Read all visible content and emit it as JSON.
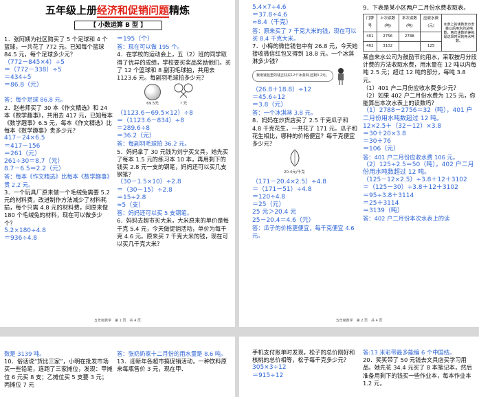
{
  "page1": {
    "title_pre": "五年级上册",
    "title_hl": "经济和促销问题",
    "title_post": "精炼",
    "subtitle": "【 小数运算 B 型 】",
    "col1": {
      "q1": "1．张阿姨为社区购买了 5 个足球和 4 个篮球，一共花了 772 元。已知每个篮球 84.5 元，每个足球多少元？",
      "q1_s": [
        "（772－845×4）÷5",
        "＝（772－338）÷5",
        "＝434÷5",
        "＝86.8（元）"
      ],
      "q1_a": "答：每个足球 86.8 元。",
      "q2": "2．赵老师买了 30 本《作文精选》和 24 本《数学趣事》，共用去 417 元，已知每本《数学趣事》6.5 元，每本《作文精选》比每本《数学趣事》贵多少元？",
      "q2_s": [
        "417－24×6.5",
        "＝417－156",
        "＝261（元）",
        "261÷30＝8.7（元）",
        "8.7－6.5＝2.2（元）"
      ],
      "q2_a": "答：每本《作文精选》比每本《数学趣事》贵 2.2 元。",
      "q3": "3．一个玩具厂原来做一个毛绒兔需要 5.2 元的材料费，改进制作方法减少了材料耗损，每个只需 4.8 元的材料费，问原来做 180 个毛绒兔的材料，现在可以做多少个？",
      "q3_s": [
        "5.2×180÷4.8",
        "＝936÷4.8"
      ]
    },
    "col2": {
      "top_s": [
        "＝195（个）"
      ],
      "top_a": "答：现在可以做 195 个。",
      "q4": "4．在学校的运动会上，五（2）班的同学取得了优异的成绩，学校要买奖品奖励他们。买了 12 个篮球和 8 副羽毛球拍，共用去 1123.6 元。每副羽毛球拍多少元？",
      "img_ball_cap": "69.5元",
      "img_racket_cap": "? 元",
      "q4_s": [
        "（1123.6－69.5×12）÷8",
        "＝（1123.6－834）÷8",
        "＝289.6÷8",
        "＝36.2（元）"
      ],
      "q4_a": "答：每副羽毛球拍 36.2 元。",
      "q5": "5．妈妈拿了 30 元钱为刘宁买文具，她先买了每本 1.5 元的练习本 10 本，再用剩下的钱买 2.8 元一支的钢笔，妈妈还可以买几支钢笔？",
      "q5_s": [
        "（30－1.5×10）÷2.8",
        "＝（30－15）÷2.8",
        "＝15÷2.8",
        "≈5（支）"
      ],
      "q5_a": "答：妈妈还可以买 5 支钢笔。",
      "q6": "6．妈妈去超市买大米，大米原来的单价是每千克 5.4 元，今天做促销活动，单价为每千克 4.6 元。原来买 7 千克大米的钱，现在可以买几千克大米？"
    },
    "footer": "五年级数学　第 1 页　共 4 页"
  },
  "page2": {
    "col1": {
      "top_s": [
        "5.4×7÷4.6",
        "＝37.8÷4.6",
        "≈8.4（千克）"
      ],
      "top_a": "答：原来买了 7 千克大米的钱，现在可以买 8.4 千克大米。",
      "q7": "7．小梅的微信钱包中有 26.8 元，今天她接收微信红包又得到 18.8 元。一个冰淇淋多少钱？",
      "bubble": "我用钱包里的钱正好买12个冰淇淋,还剩3.2元。",
      "q7_s": [
        "（26.8＋18.8）÷12",
        "＝45.6÷12",
        "＝3.8（元）"
      ],
      "q7_a": "答：一个冰淇淋 3.8 元。",
      "q8": "8．妈妈在炒货店买了 2.5 千克瓜子和 4.8 千克花生，一共花了 171 元。瓜子和花生相比，哪种的价格便宜？每千克便宜多少元？",
      "seed_cap": "20.4元/千克",
      "q8_s": [
        "（171－20.4×2.5）÷4.8",
        "＝（171－51）÷4.8",
        "＝120÷4.8",
        "＝25（元）",
        "25 元＞20.4 元",
        "25－20.4＝4.6（元）"
      ],
      "q8_a": "答：瓜子的价格更便宜，每千克便宜 4.6 元。"
    },
    "col2": {
      "q9": "9．下表是某小区两户二月份水费收取表。",
      "table": {
        "headers": [
          "门牌号",
          "上次读数(吨)",
          "本次读数(吨)",
          "应收水费(元)"
        ],
        "rows": [
          [
            "401",
            "2756",
            "2788",
            ""
          ],
          [
            "402",
            "3102",
            "",
            "125"
          ]
        ],
        "note": "水表上的读数表示安装以后用水的总吨数，两次读数的差就是这段时间的用水吨数。"
      },
      "q9_text": "某自来水公司为鼓励节约用水，采取按月分段计费的方法收取水费，用水量在 12 吨以内每吨 2.5 元；超过 12 吨的部分，每吨 3.8 元。",
      "q9_1": "（1）401 户二月份应收水费多少元？",
      "q9_2": "（2）如果 402 户二月份水费为 125 元，你能算出本次水表上的读数吗？",
      "q9_1s": [
        "（1）2788－2756＝32（吨），401 户二月份用水吨数超过 12 吨。",
        "12×2.5＋（32－12）×3.8",
        "＝30＋20×3.8",
        "＝30＋76",
        "＝106（元）"
      ],
      "q9_1a": "答：401 户二月份应收水费 106 元。",
      "q9_2s": [
        "（2）125÷2.5＝50（吨），402 户二月份用水吨数超过 12 吨。",
        "（125－12×2.5）÷3.8＋12＋3102",
        "＝（125－30）÷3.8＋12＋3102",
        "＝95÷3.8＋3114",
        "＝25＋3114",
        "＝3139（吨）"
      ],
      "q9_2a": "答：402 户二月份本次水表上的读"
    },
    "footer": "五年级数学　第 2 页　共 4 页"
  },
  "page3": {
    "col1": {
      "top": "数是 3139 吨。",
      "q10": "10．俗话说“货比三家”，小明在批发市场买一些铅笔，连跑了三家摊位，发现：甲摊位 6 元买 8 支；乙摊位买 5 支要 3 元；丙摊位 7 元"
    },
    "col2": {
      "top_a": "答：张奶奶家十二月份的用水量是 8.6 吨。",
      "q13": "13．迎新年各超市搞促销活动，一种饮料原来每瓶售价 3 元，现在甲、"
    }
  },
  "page4": {
    "col1": {
      "top": "手机支付账单时发现，松子的总价刚好和核桃的总价相等，松子每千克多少元？",
      "s": [
        "305×3÷12",
        "＝915÷12"
      ]
    },
    "col2": {
      "top_a": "答:13 米彩带最多能编 6 个中国结。",
      "q20": "20．笑笑带了 50 元钱去文具店买学习用品。她先花 34.4 元买了 8 本笔记本，然后准备用剩下的钱买一些作业本，每本作业本 1.2 元，"
    }
  }
}
